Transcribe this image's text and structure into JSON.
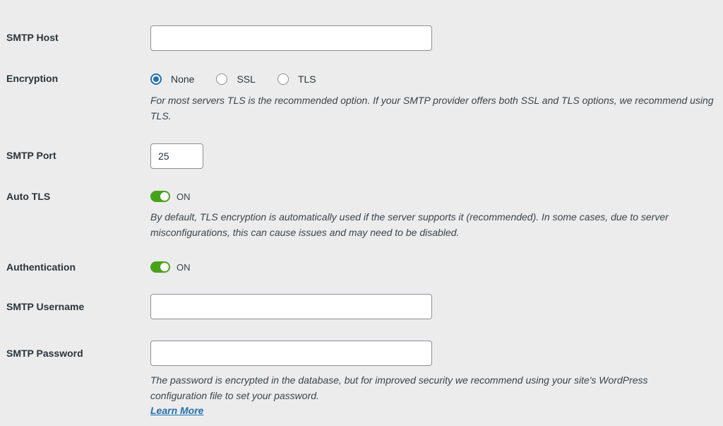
{
  "fields": {
    "smtp_host": {
      "label": "SMTP Host",
      "value": ""
    },
    "encryption": {
      "label": "Encryption",
      "options": [
        {
          "label": "None",
          "checked": true
        },
        {
          "label": "SSL",
          "checked": false
        },
        {
          "label": "TLS",
          "checked": false
        }
      ],
      "description": "For most servers TLS is the recommended option. If your SMTP provider offers both SSL and TLS options, we recommend using TLS."
    },
    "smtp_port": {
      "label": "SMTP Port",
      "value": "25"
    },
    "auto_tls": {
      "label": "Auto TLS",
      "state": "ON",
      "enabled": true,
      "description": "By default, TLS encryption is automatically used if the server supports it (recommended). In some cases, due to server misconfigurations, this can cause issues and may need to be disabled."
    },
    "authentication": {
      "label": "Authentication",
      "state": "ON",
      "enabled": true
    },
    "smtp_username": {
      "label": "SMTP Username",
      "value": ""
    },
    "smtp_password": {
      "label": "SMTP Password",
      "value": "",
      "description": "The password is encrypted in the database, but for improved security we recommend using your site's WordPress configuration file to set your password.",
      "link_label": "Learn More"
    }
  },
  "colors": {
    "background": "#ececec",
    "accent": "#2271b1",
    "toggle_on": "#46a319"
  }
}
